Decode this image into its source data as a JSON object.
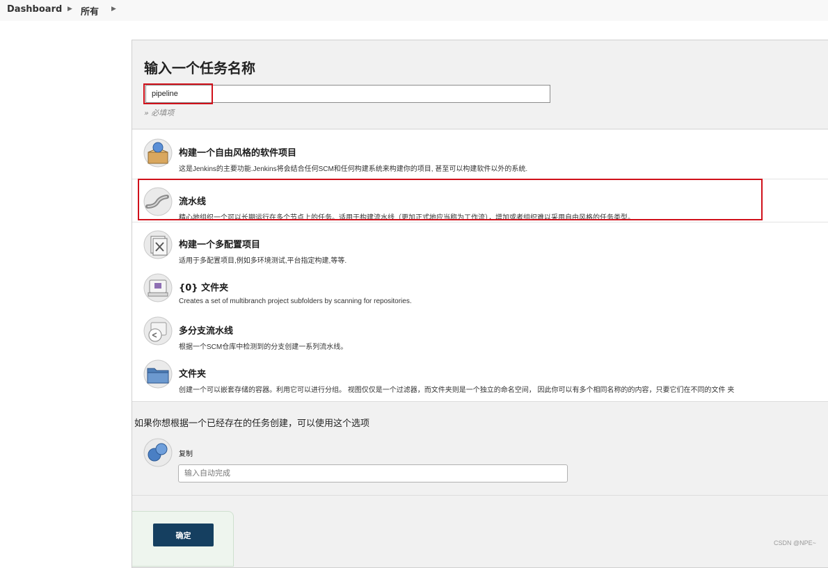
{
  "breadcrumb": {
    "items": [
      "Dashboard",
      "所有"
    ]
  },
  "form": {
    "title": "输入一个任务名称",
    "name_value": "pipeline",
    "required_note": "» 必填项"
  },
  "item_types": [
    {
      "title": "构建一个自由风格的软件项目",
      "description": "这是Jenkins的主要功能.Jenkins将会结合任何SCM和任何构建系统来构建你的项目, 甚至可以构建软件以外的系统.",
      "icon": "freestyle-project-icon"
    },
    {
      "title": "流水线",
      "description": "精心地组织一个可以长期运行在多个节点上的任务。适用于构建流水线（更加正式地应当称为工作流），增加或者组织难以采用自由风格的任务类型。",
      "icon": "pipeline-icon"
    },
    {
      "title": "构建一个多配置项目",
      "description": "适用于多配置项目,例如多环境测试,平台指定构建,等等.",
      "icon": "multi-config-icon"
    },
    {
      "title": "{0} 文件夹",
      "description": "Creates a set of multibranch project subfolders by scanning for repositories.",
      "icon": "org-folder-icon"
    },
    {
      "title": "多分支流水线",
      "description": "根据一个SCM仓库中检测到的分支创建一系列流水线。",
      "icon": "multibranch-pipeline-icon"
    },
    {
      "title": "文件夹",
      "description": "创建一个可以嵌套存储的容器。利用它可以进行分组。 视图仅仅是一个过滤器，而文件夹则是一个独立的命名空间， 因此你可以有多个相同名称的的内容，只要它们在不同的文件 夹",
      "icon": "folder-icon"
    }
  ],
  "copy": {
    "heading": "如果你想根据一个已经存在的任务创建，可以使用这个选项",
    "label": "复制",
    "placeholder": "输入自动完成"
  },
  "actions": {
    "ok_label": "确定"
  },
  "watermark": "CSDN @NPE~",
  "colors": {
    "highlight": "#d0101a",
    "ok_button": "#153f60"
  }
}
